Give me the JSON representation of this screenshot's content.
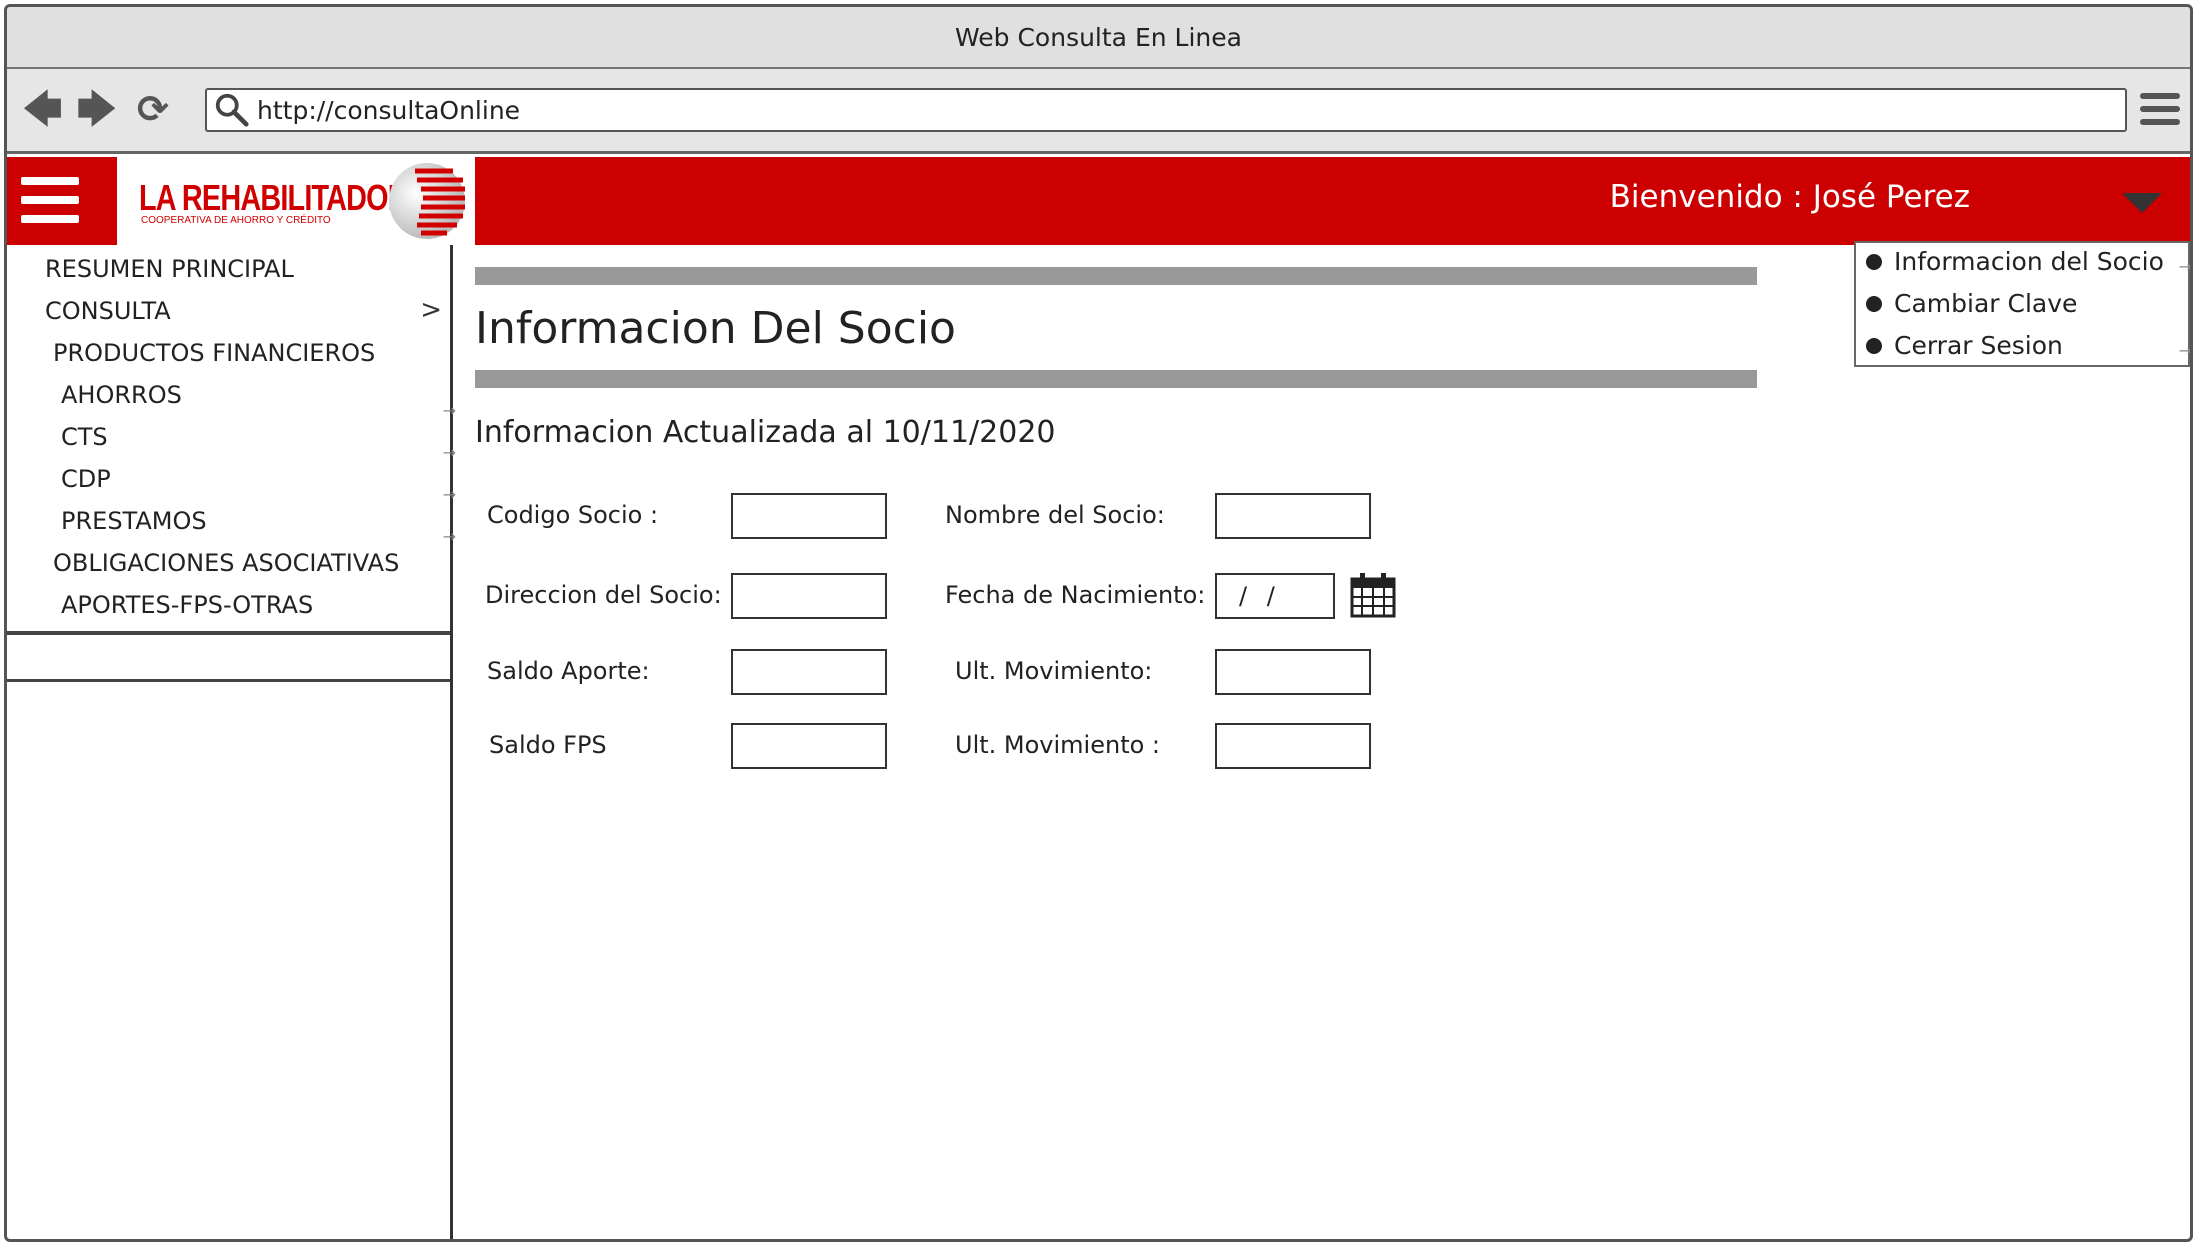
{
  "window": {
    "title": "Web Consulta En Linea"
  },
  "browser": {
    "url": "http://consultaOnline"
  },
  "header": {
    "brand": "LA REHABILITADORA",
    "brand_sub": "COOPERATIVA DE AHORRO Y CRÉDITO",
    "welcome": "Bienvenido : José Perez",
    "accent": "#cc0000"
  },
  "user_menu": {
    "items": [
      "Informacion del Socio",
      "Cambiar Clave",
      "Cerrar Sesion"
    ]
  },
  "sidebar": {
    "items": [
      "RESUMEN PRINCIPAL",
      "CONSULTA",
      "PRODUCTOS FINANCIEROS",
      "AHORROS",
      "CTS",
      "CDP",
      "PRESTAMOS",
      "OBLIGACIONES ASOCIATIVAS",
      "APORTES-FPS-OTRAS"
    ],
    "consulta_chevron": ">"
  },
  "main": {
    "title": "Informacion Del Socio",
    "subtitle": "Informacion Actualizada al 10/11/2020",
    "form": {
      "codigo_label": "Codigo Socio :",
      "nombre_label": "Nombre del Socio:",
      "direccion_label": "Direccion del Socio:",
      "fecha_label": "Fecha de Nacimiento:",
      "fecha_value": "/ /",
      "saldo_aporte_label": "Saldo Aporte:",
      "ult_mov_1_label": "Ult. Movimiento:",
      "saldo_fps_label": "Saldo FPS",
      "ult_mov_2_label": "Ult. Movimiento :"
    }
  }
}
